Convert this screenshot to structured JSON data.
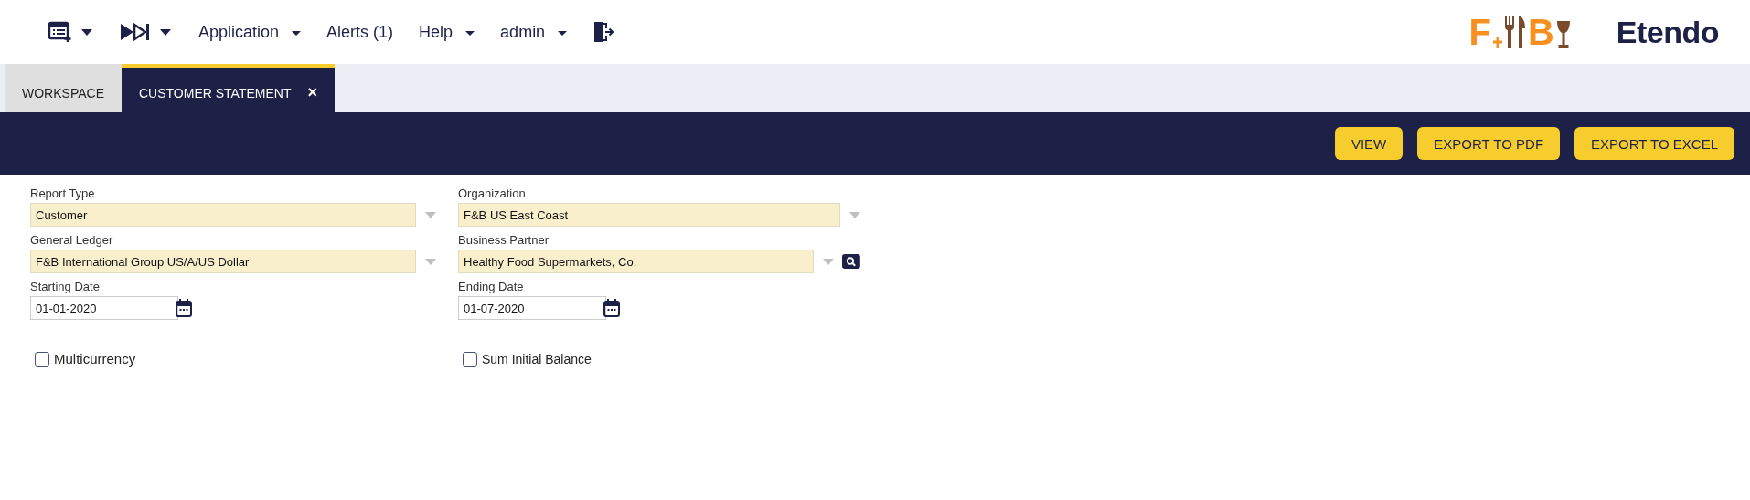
{
  "menu": [
    {
      "kind": "windows"
    },
    {
      "kind": "flows"
    },
    {
      "kind": "text-dropdown",
      "label": "Application"
    },
    {
      "kind": "text",
      "label": "Alerts (1)"
    },
    {
      "kind": "text-dropdown",
      "label": "Help"
    },
    {
      "kind": "text-dropdown",
      "label": "admin"
    },
    {
      "kind": "logout"
    }
  ],
  "logos": {
    "fb_letters": [
      "F",
      "B"
    ],
    "brand": "Etendo"
  },
  "tabs": [
    {
      "label": "WORKSPACE",
      "selected": false
    },
    {
      "label": "CUSTOMER STATEMENT",
      "selected": true,
      "close": "×"
    }
  ],
  "toolbar": {
    "buttons": [
      "VIEW",
      "EXPORT TO PDF",
      "EXPORT TO EXCEL"
    ]
  },
  "form": {
    "fields": [
      {
        "label": "Report Type",
        "value": "Customer",
        "kind": "select"
      },
      {
        "label": "Organization",
        "value": "F&B US East Coast",
        "kind": "select"
      },
      {
        "label": "General Ledger",
        "value": "F&B International Group US/A/US Dollar",
        "kind": "select"
      },
      {
        "label": "Business Partner",
        "value": "Healthy Food Supermarkets, Co.",
        "kind": "search"
      },
      {
        "label": "Starting Date",
        "value": "01-01-2020",
        "kind": "date"
      },
      {
        "label": "Ending Date",
        "value": "01-07-2020",
        "kind": "date"
      }
    ],
    "checkboxes": [
      {
        "label": "Multicurrency",
        "checked": false
      },
      {
        "label": "Sum Initial Balance",
        "checked": false
      }
    ]
  }
}
